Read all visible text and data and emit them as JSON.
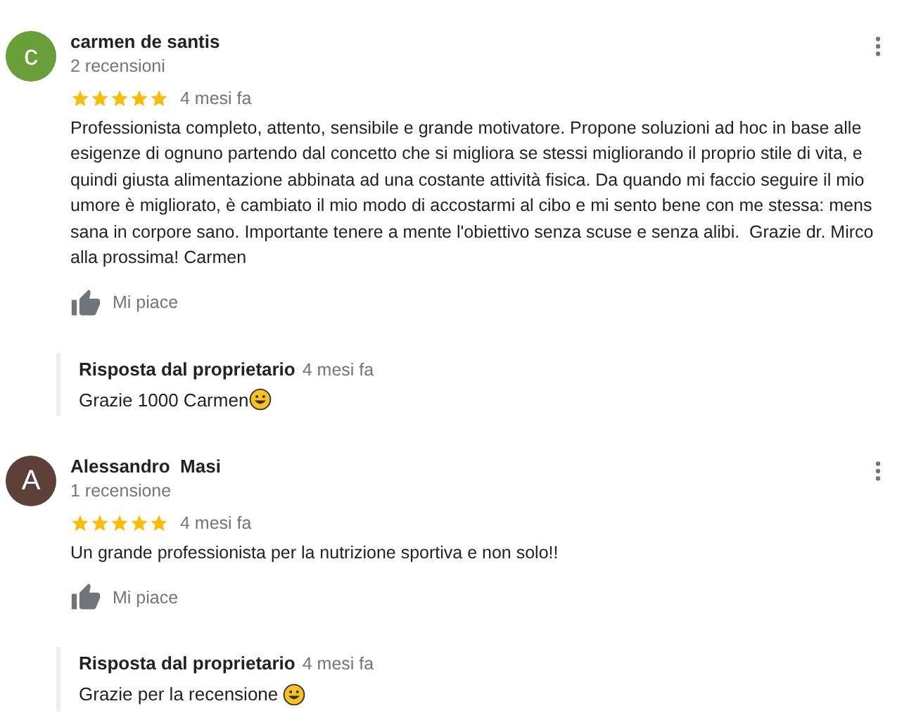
{
  "reviews": [
    {
      "avatar_letter": "c",
      "color": "#689f38",
      "author": "carmen de santis",
      "review_count": "2 recensioni",
      "stars": 5,
      "time": "4 mesi fa",
      "text": "Professionista completo, attento, sensibile e grande motivatore. Propone soluzioni ad hoc in base alle esigenze di ognuno partendo dal concetto che si migliora se stessi migliorando il proprio stile di vita, e quindi giusta alimentazione abbinata ad una costante attività fisica. Da quando mi faccio seguire il mio umore è migliorato, è cambiato il mio modo di accostarmi al cibo e mi sento bene con me stessa: mens sana in corpore sano. Importante tenere a mente l'obiettivo senza scuse e senza alibi.  Grazie dr. Mirco alla prossima! Carmen",
      "like_label": "Mi piace",
      "reply": {
        "label": "Risposta dal proprietario",
        "time": "4 mesi fa",
        "text": "Grazie 1000 Carmen"
      }
    },
    {
      "avatar_letter": "A",
      "color": "#5d4037",
      "author": "Alessandro  Masi",
      "review_count": "1 recensione",
      "stars": 5,
      "time": "4 mesi fa",
      "text": "Un grande professionista per la nutrizione sportiva e non solo!!",
      "like_label": "Mi piace",
      "reply": {
        "label": "Risposta dal proprietario",
        "time": "4 mesi fa",
        "text": "Grazie per la recensione "
      }
    }
  ]
}
